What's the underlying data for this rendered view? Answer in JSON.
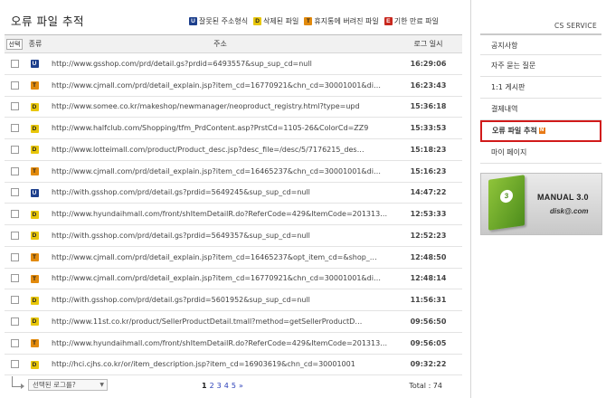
{
  "page": {
    "title": "오류 파일 추적"
  },
  "legend": [
    {
      "code": "U",
      "label": "잘못된 주소형식"
    },
    {
      "code": "D",
      "label": "삭제된 파일"
    },
    {
      "code": "T",
      "label": "휴지통에 버려진 파일"
    },
    {
      "code": "E",
      "label": "기한 만료 파일"
    }
  ],
  "table": {
    "headers": {
      "select": "선택",
      "type": "종류",
      "url": "주소",
      "time": "로그 일시"
    },
    "rows": [
      {
        "type": "U",
        "url": "http://www.gsshop.com/prd/detail.gs?prdid=6493557&sup_sup_cd=null",
        "time": "16:29:06"
      },
      {
        "type": "T",
        "url": "http://www.cjmall.com/prd/detail_explain.jsp?item_cd=16770921&chn_cd=30001001&di…",
        "time": "16:23:43"
      },
      {
        "type": "D",
        "url": "http://www.somee.co.kr/makeshop/newmanager/neoproduct_registry.html?type=upd",
        "time": "15:36:18"
      },
      {
        "type": "D",
        "url": "http://www.halfclub.com/Shopping/tfm_PrdContent.asp?PrstCd=1105-26&ColorCd=ZZ9",
        "time": "15:33:53"
      },
      {
        "type": "D",
        "url": "http://www.lotteimall.com/product/Product_desc.jsp?desc_file=/desc/5/7176215_des…",
        "time": "15:18:23"
      },
      {
        "type": "T",
        "url": "http://www.cjmall.com/prd/detail_explain.jsp?item_cd=16465237&chn_cd=30001001&di…",
        "time": "15:16:23"
      },
      {
        "type": "U",
        "url": "http://with.gsshop.com/prd/detail.gs?prdid=5649245&sup_sup_cd=null",
        "time": "14:47:22"
      },
      {
        "type": "D",
        "url": "http://www.hyundaihmall.com/front/shItemDetailR.do?ReferCode=429&ItemCode=201313…",
        "time": "12:53:33"
      },
      {
        "type": "D",
        "url": "http://with.gsshop.com/prd/detail.gs?prdid=5649357&sup_sup_cd=null",
        "time": "12:52:23"
      },
      {
        "type": "T",
        "url": "http://www.cjmall.com/prd/detail_explain.jsp?item_cd=16465237&opt_item_cd=&shop_…",
        "time": "12:48:50"
      },
      {
        "type": "T",
        "url": "http://www.cjmall.com/prd/detail_explain.jsp?item_cd=16770921&chn_cd=30001001&di…",
        "time": "12:48:14"
      },
      {
        "type": "D",
        "url": "http://with.gsshop.com/prd/detail.gs?prdid=5601952&sup_sup_cd=null",
        "time": "11:56:31"
      },
      {
        "type": "D",
        "url": "http://www.11st.co.kr/product/SellerProductDetail.tmall?method=getSellerProductD…",
        "time": "09:56:50"
      },
      {
        "type": "T",
        "url": "http://www.hyundaihmall.com/front/shItemDetailR.do?ReferCode=429&ItemCode=201313…",
        "time": "09:56:05"
      },
      {
        "type": "D",
        "url": "http://hci.cjhs.co.kr/or/item_description.jsp?item_cd=16903619&chn_cd=30001001",
        "time": "09:32:22"
      }
    ]
  },
  "footer": {
    "action_select": "선택된 로그를?",
    "pages": [
      "1",
      "2",
      "3",
      "4",
      "5",
      "»"
    ],
    "total": "Total : 74"
  },
  "sidebar": {
    "title": "CS SERVICE",
    "items": [
      {
        "label": "공지사항"
      },
      {
        "label": "자주 묻는 질문"
      },
      {
        "label": "1:1 게시판"
      },
      {
        "label": "결제내역"
      },
      {
        "label": "오류 파일 추적",
        "badge": "N"
      },
      {
        "label": "마이 페이지"
      }
    ],
    "banner": {
      "book_number": "3",
      "title": "MANUAL 3.0",
      "brand": "disk@.com"
    }
  }
}
